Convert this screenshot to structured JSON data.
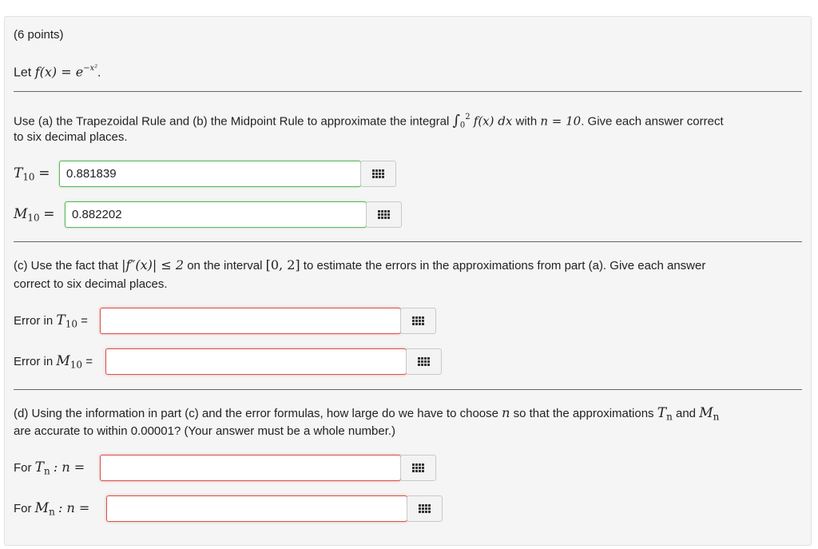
{
  "problem": {
    "points": "(6 points)",
    "let_prefix": "Let",
    "function_lhs": "f(x) = e",
    "function_exponent": "−x²",
    "function_end": "."
  },
  "part_ab": {
    "instruction_pre": "Use (a) the Trapezoidal Rule and (b) the Midpoint Rule to approximate the integral",
    "integral_upper": "2",
    "integral_lower": "0",
    "integral_body": "f(x) dx",
    "with_text": "with",
    "n_expr": "n = 10",
    "instruction_post": ". Give each answer correct",
    "instruction_line2": "to six decimal places.",
    "t_label_main": "T",
    "t_label_sub": "10",
    "t_label_eq": "=",
    "t_value": "0.881839",
    "m_label_main": "M",
    "m_label_sub": "10",
    "m_label_eq": "=",
    "m_value": "0.882202"
  },
  "part_c": {
    "instruction_pre": "(c) Use the fact that",
    "bound_expr": "|f″(x)| ≤ 2",
    "on_text": "on the interval",
    "interval": "[0, 2]",
    "instruction_post": "to estimate the errors in the approximations from part (a). Give each answer",
    "instruction_line2": "correct to six decimal places.",
    "err_t_prefix": "Error in",
    "err_t_main": "T",
    "err_t_sub": "10",
    "err_t_eq": "=",
    "err_t_value": "",
    "err_m_prefix": "Error in",
    "err_m_main": "M",
    "err_m_sub": "10",
    "err_m_eq": "=",
    "err_m_value": ""
  },
  "part_d": {
    "instruction_pre": "(d) Using the information in part (c) and the error formulas, how large do we have to choose",
    "n_var": "n",
    "instruction_mid": "so that the approximations",
    "tn_main": "T",
    "tn_sub": "n",
    "and_text": "and",
    "mn_main": "M",
    "mn_sub": "n",
    "instruction_line2": "are accurate to within 0.00001? (Your answer must be a whole number.)",
    "for_t_prefix": "For",
    "for_t_main": "T",
    "for_t_sub": "n",
    "for_t_rest": ": n =",
    "for_t_value": "",
    "for_m_prefix": "For",
    "for_m_main": "M",
    "for_m_sub": "n",
    "for_m_rest": ": n =",
    "for_m_value": ""
  },
  "colors": {
    "correct_border": "#5cb85c",
    "incorrect_border": "#d9534f",
    "panel_bg": "#f5f5f5"
  },
  "icons": {
    "equation_editor": "grid-icon"
  }
}
